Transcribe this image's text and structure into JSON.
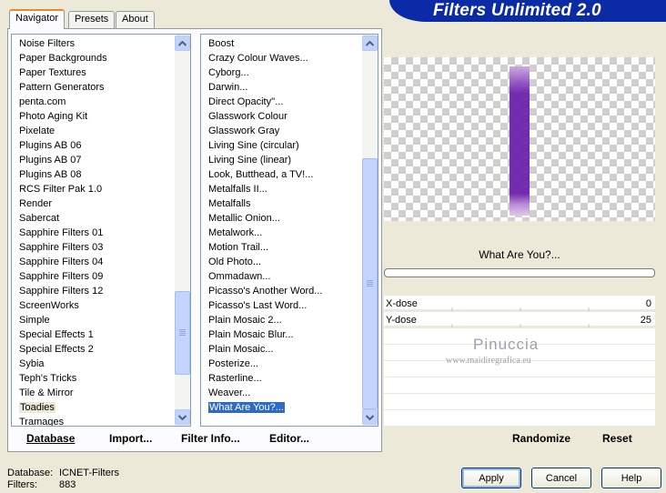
{
  "header": {
    "title": "Filters Unlimited 2.0"
  },
  "tabs": [
    {
      "label": "Navigator",
      "active": true
    },
    {
      "label": "Presets",
      "active": false
    },
    {
      "label": "About",
      "active": false
    }
  ],
  "categories": {
    "items": [
      "Noise Filters",
      "Paper Backgrounds",
      "Paper Textures",
      "Pattern Generators",
      "penta.com",
      "Photo Aging Kit",
      "Pixelate",
      "Plugins AB 06",
      "Plugins AB 07",
      "Plugins AB 08",
      "RCS Filter Pak 1.0",
      "Render",
      "Sabercat",
      "Sapphire Filters 01",
      "Sapphire Filters 03",
      "Sapphire Filters 04",
      "Sapphire Filters 09",
      "Sapphire Filters 12",
      "ScreenWorks",
      "Simple",
      "Special Effects 1",
      "Special Effects 2",
      "Sybia",
      "Teph's Tricks",
      "Tile & Mirror",
      "Toadies",
      "Tramages"
    ],
    "selected": "Toadies"
  },
  "filters": {
    "items": [
      "Boost",
      "Crazy Colour Waves...",
      "Cyborg...",
      "Darwin...",
      "Direct Opacity''...",
      "Glasswork Colour",
      "Glasswork Gray",
      "Living Sine (circular)",
      "Living Sine (linear)",
      "Look, Butthead, a TV!...",
      "Metalfalls II...",
      "Metalfalls",
      "Metallic Onion...",
      "Metalwork...",
      "Motion Trail...",
      "Old Photo...",
      "Ommadawn...",
      "Picasso's Another Word...",
      "Picasso's Last Word...",
      "Plain Mosaic 2...",
      "Plain Mosaic Blur...",
      "Plain Mosaic...",
      "Posterize...",
      "Rasterline...",
      "Weaver...",
      "What Are You?..."
    ],
    "selected": "What Are You?..."
  },
  "left_buttons": {
    "database": "Database",
    "import": "Import...",
    "filter_info": "Filter Info...",
    "editor": "Editor..."
  },
  "preview": {
    "filter_name": "What Are You?..."
  },
  "params": [
    {
      "label": "X-dose",
      "value": "0"
    },
    {
      "label": "Y-dose",
      "value": "25"
    }
  ],
  "watermark": {
    "name": "Pinuccia",
    "site": "www.maidiregrafica.eu"
  },
  "right_buttons": {
    "randomize": "Randomize",
    "reset": "Reset"
  },
  "footer": {
    "database_label": "Database:",
    "database_value": "ICNET-Filters",
    "filters_label": "Filters:",
    "filters_value": "883"
  },
  "dialog_buttons": {
    "apply": "Apply",
    "cancel": "Cancel",
    "help": "Help"
  },
  "colors": {
    "banner": "#0b2aa6",
    "selection": "#316ac5",
    "preview_shape": "#6d22ad"
  }
}
